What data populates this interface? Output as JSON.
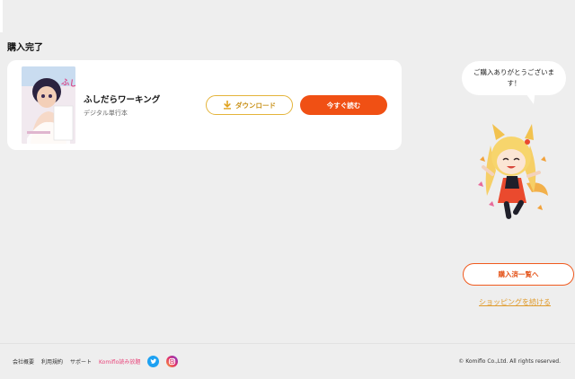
{
  "page": {
    "title": "購入完了"
  },
  "purchase": {
    "book_title": "ふしだらワーキング",
    "book_format": "デジタル単行本",
    "cover_title": "ふしだら",
    "download_label": "ダウンロード",
    "read_label": "今すぐ読む"
  },
  "mascot": {
    "speech": "ご購入ありがとうございます！"
  },
  "actions": {
    "history_label": "購入済一覧へ",
    "continue_label": "ショッピングを続ける"
  },
  "footer": {
    "links": [
      "会社概要",
      "利用規約",
      "サポート",
      "Komiflo読み放題"
    ],
    "copyright": "© Komiflo Co.,Ltd. All rights reserved."
  },
  "colors": {
    "accent_orange": "#f05014",
    "download_gold": "#e4b43a",
    "link_pink": "#e8447a",
    "twitter_blue": "#1da1f2"
  },
  "icons": {
    "download": "download-icon",
    "twitter": "twitter-icon",
    "instagram": "instagram-icon"
  }
}
